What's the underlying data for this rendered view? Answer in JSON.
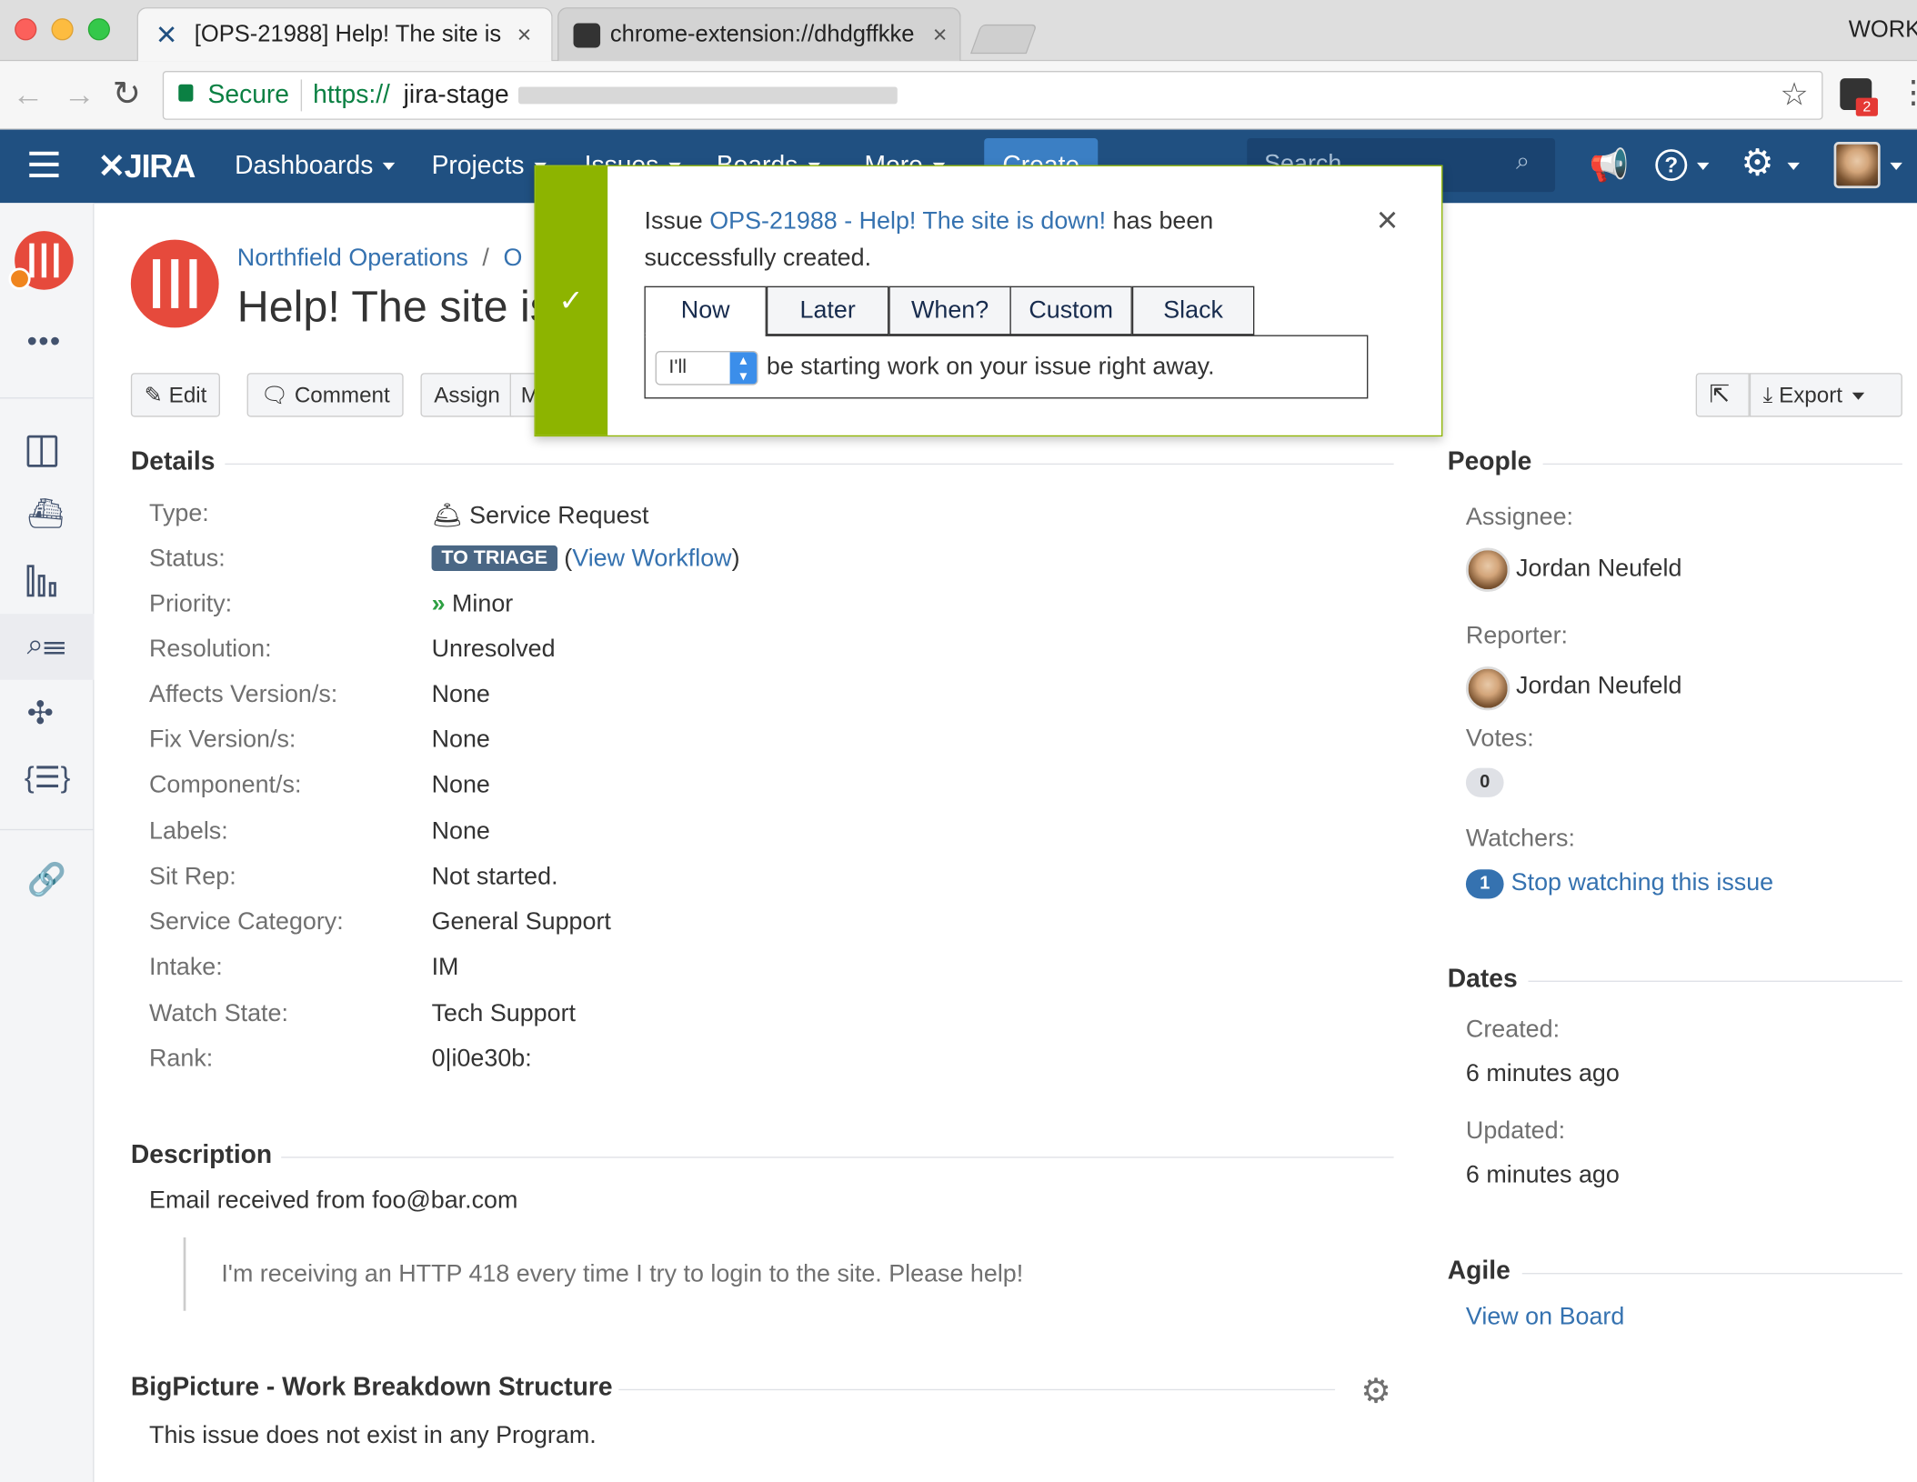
{
  "browser": {
    "tabs": [
      {
        "title": "[OPS-21988] Help! The site is"
      },
      {
        "title": "chrome-extension://dhdgffkke"
      }
    ],
    "window_label": "WORK",
    "secure_label": "Secure",
    "url_scheme": "https://",
    "url_host": "jira-stage",
    "extension_badge": "2"
  },
  "nav": {
    "logo": "JIRA",
    "items": [
      "Dashboards",
      "Projects",
      "Issues",
      "Boards",
      "More"
    ],
    "create_label": "Create",
    "search_placeholder": "Search"
  },
  "breadcrumb": {
    "project": "Northfield Operations",
    "separator": "/",
    "next": "O"
  },
  "issue": {
    "title": "Help! The site is"
  },
  "actions": {
    "edit": "Edit",
    "comment": "Comment",
    "assign": "Assign",
    "more": "M",
    "export": "Export"
  },
  "details": {
    "heading": "Details",
    "rows": [
      {
        "label": "Type:",
        "value": "Service Request"
      },
      {
        "label": "Status:",
        "value": ""
      },
      {
        "label": "Priority:",
        "value": "Minor"
      },
      {
        "label": "Resolution:",
        "value": "Unresolved"
      },
      {
        "label": "Affects Version/s:",
        "value": "None"
      },
      {
        "label": "Fix Version/s:",
        "value": "None"
      },
      {
        "label": "Component/s:",
        "value": "None"
      },
      {
        "label": "Labels:",
        "value": "None"
      },
      {
        "label": "Sit Rep:",
        "value": "Not started."
      },
      {
        "label": "Service Category:",
        "value": "General Support"
      },
      {
        "label": "Intake:",
        "value": "IM"
      },
      {
        "label": "Watch State:",
        "value": "Tech Support"
      },
      {
        "label": "Rank:",
        "value": "0|i0e30b:"
      }
    ],
    "status_badge": "TO TRIAGE",
    "status_open": "(",
    "view_workflow": "View Workflow",
    "status_close": ")"
  },
  "description": {
    "heading": "Description",
    "text": "Email received from foo@bar.com",
    "quote": "I'm receiving an HTTP 418 every time I try to login to the site. Please help!"
  },
  "bigpicture": {
    "heading": "BigPicture - Work Breakdown Structure",
    "text": "This issue does not exist in any Program."
  },
  "people": {
    "heading": "People",
    "assignee_label": "Assignee:",
    "assignee": "Jordan Neufeld",
    "reporter_label": "Reporter:",
    "reporter": "Jordan Neufeld",
    "votes_label": "Votes:",
    "votes": "0",
    "watchers_label": "Watchers:",
    "watchers": "1",
    "stop_watching": "Stop watching this issue"
  },
  "dates": {
    "heading": "Dates",
    "created_label": "Created:",
    "created": "6 minutes ago",
    "updated_label": "Updated:",
    "updated": "6 minutes ago"
  },
  "agile": {
    "heading": "Agile",
    "view_on_board": "View on Board"
  },
  "flag": {
    "prefix": "Issue ",
    "issue_link": "OPS-21988 - Help! The site is down!",
    "suffix": " has been",
    "line2": "successfully created.",
    "segments": [
      "Now",
      "Later",
      "When?",
      "Custom",
      "Slack"
    ],
    "select_value": "I'll",
    "message": "be starting work on your issue right away."
  },
  "colors": {
    "nav": "#205081",
    "link": "#3572b0",
    "success": "#8db400",
    "status_badge": "#4a6785"
  }
}
